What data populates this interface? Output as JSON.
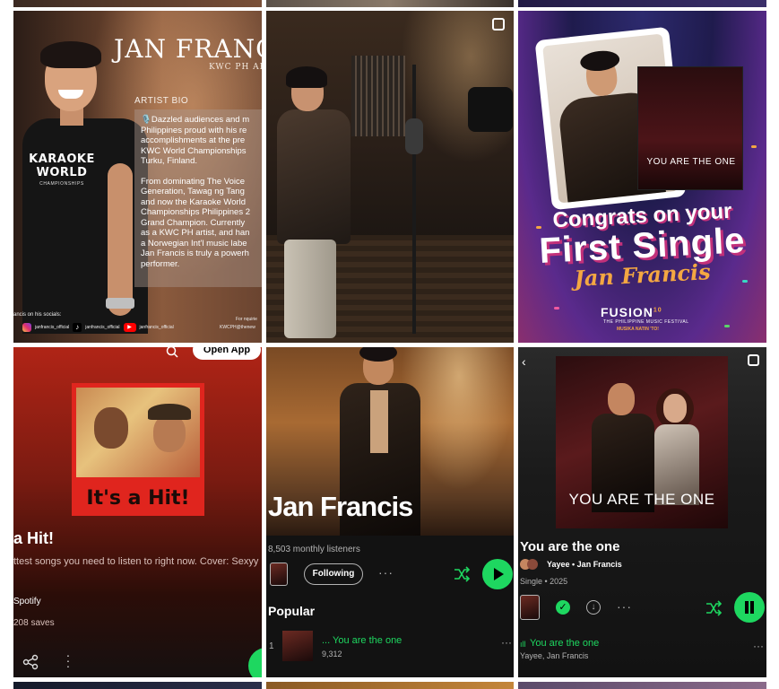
{
  "tiles": {
    "bio": {
      "title": "JAN FRANC",
      "subtitle": "KWC PH AR",
      "bio_label": "ARTIST BIO",
      "bio_p1": "🎙️Dazzled audiences and m\nPhilippines proud with his re\naccomplishments at the pre\nKWC World Championships\nTurku, Finland.",
      "bio_p2": "From dominating The Voice\nGeneration, Tawag ng Tang\nand now the Karaoke World\nChampionships Philippines 2\nGrand Champion. Currently\nas a KWC PH artist, and han\na Norwegian Int'l music labe\nJan Francis is truly a powerh\nperformer.",
      "shirt_logo": "KARAOKE WORLD",
      "shirt_sub": "CHAMPIONSHIPS",
      "socials_label": "ancis on his socials:",
      "social_ig": "janfrancis_official",
      "social_tt": "janfrancis_official",
      "social_yt": "janfrancis_official",
      "inquiries": "For nquirie",
      "inquiries_email": "KWCPH@thenew"
    },
    "studio": {},
    "congrats": {
      "cover_text": "YOU ARE THE ONE",
      "line1": "Congrats on your",
      "line2": "First Single",
      "line3": "Jan Francis",
      "festival": "FUSION",
      "festival_num": "10",
      "festival_sub": "THE PHILIPPINE MUSIC FESTIVAL",
      "festival_tag": "MUSIKA NATIN 'TO!"
    },
    "playlist": {
      "open_app": "Open App",
      "cover_band": "It's a Hit!",
      "title": "a Hit!",
      "description": "ttest songs you need to listen to right now. Cover: Sexyy Red,",
      "owner": "Spotify",
      "saves": "208 saves"
    },
    "artist": {
      "name": "Jan Francis",
      "listeners": "8,503 monthly listeners",
      "follow_label": "Following",
      "popular_label": "Popular",
      "track_num": "1",
      "track_title": "... You are the one",
      "track_plays": "9,312"
    },
    "now_playing": {
      "art_text": "YOU ARE THE ONE",
      "song": "You are the one",
      "artists": "Yayee • Jan Francis",
      "meta": "Single • 2025",
      "np_title": "You are the one",
      "np_artists": "Yayee, Jan Francis"
    }
  },
  "colors": {
    "spotify_green": "#1ed760",
    "background": "#ffffff"
  }
}
